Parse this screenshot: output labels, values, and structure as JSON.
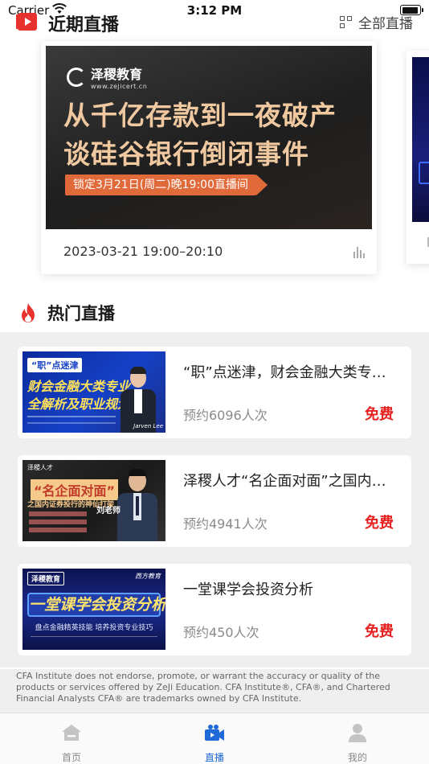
{
  "status_bar": {
    "carrier": "Carrier",
    "time": "3:12 PM"
  },
  "recent_section": {
    "title": "近期直播",
    "all_link": "全部直播",
    "featured": {
      "brand_name": "泽稷教育",
      "brand_url": "www.zejicert.cn",
      "headline_1": "从千亿存款到一夜破产",
      "headline_2": "谈硅谷银行倒闭事件",
      "schedule_tag": "锁定3月21日(周二)晚19:00直播间",
      "date_range": "2023-03-21 19:00–20:10"
    }
  },
  "hot_section": {
    "title": "热门直播",
    "items": [
      {
        "title": "“职”点迷津，财会金融大类专业全解析及职业规划",
        "count": "预约6096人次",
        "price": "免费",
        "thumb": {
          "tag": "“职”点迷津",
          "line1": "财会金融大类专业",
          "line2": "全解析及职业规划",
          "name": "Jarven Lee"
        }
      },
      {
        "title": "泽稷人才“名企面对面”之国内证券投行的神仙打架",
        "count": "预约4941人次",
        "price": "免费",
        "thumb": {
          "brand": "泽稷人才",
          "line1": "“名企面对面”",
          "line2": "之国内证券投行的神仙打架",
          "name": "刘老师"
        }
      },
      {
        "title": "一堂课学会投资分析",
        "count": "预约450人次",
        "price": "免费",
        "thumb": {
          "brand": "泽稷教育",
          "brand2": "西方教育",
          "line1": "一堂课学会投资分析",
          "line2": "盘点金融精英技能   培养投资专业技巧"
        }
      }
    ]
  },
  "disclaimer": "CFA Institute does not endorse, promote, or warrant the accuracy or quality of the products or services offered by ZeJi Education. CFA Institute®, CFA®, and Chartered Financial Analysts CFA® are trademarks owned by CFA Institute.",
  "tabbar": {
    "tabs": [
      {
        "label": "首页",
        "icon": "home-icon",
        "active": false
      },
      {
        "label": "直播",
        "icon": "live-camera-icon",
        "active": true
      },
      {
        "label": "我的",
        "icon": "profile-icon",
        "active": false
      }
    ]
  },
  "colors": {
    "accent": "#1f6ad6",
    "price": "#e6201f",
    "brand_red": "#e8322d"
  }
}
